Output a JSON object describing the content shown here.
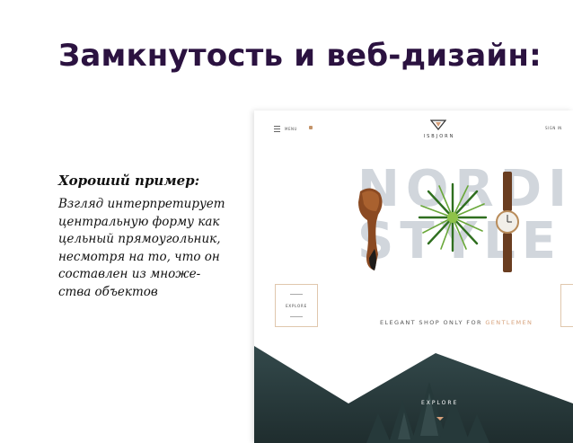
{
  "slide": {
    "title": "Замкнутость и веб-дизайн:"
  },
  "example": {
    "heading": "Хороший пример:",
    "lines": [
      "Взгляд интерпретирует",
      "центральную форму как",
      "цельный прямоугольник,",
      "несмотря на то, что он",
      "составлен из множе-",
      "ства объектов"
    ]
  },
  "mockup": {
    "nav_menu_label": "MENU",
    "nav_signin_label": "SIGN IN",
    "logo_text": "ISBJORN",
    "hero_line1": "NORDIC",
    "hero_line2": "STYLE",
    "explore_box_label": "EXPLORE",
    "tagline_main": "ELEGANT SHOP ONLY FOR",
    "tagline_accent": "GENTLEMEN",
    "explore_bottom_label": "EXPLORE",
    "icons": [
      "hamburger-icon",
      "bag-icon",
      "logo-icon",
      "arrow-down-icon"
    ],
    "colors": {
      "title": "#2b1240",
      "accent": "#d6a07a",
      "hero_text": "#d1d6dc",
      "forest": "#2c3b3d"
    }
  }
}
